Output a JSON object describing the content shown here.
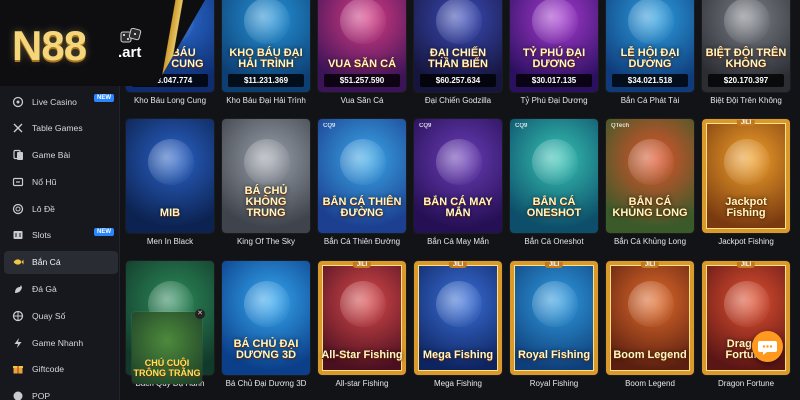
{
  "brand": {
    "logo": "N88",
    "suffix": ".art"
  },
  "nav": [
    {
      "id": "live-casino",
      "label": "Live Casino",
      "icon": "live-casino-icon",
      "badge": "NEW"
    },
    {
      "id": "table-games",
      "label": "Table Games",
      "icon": "table-games-icon"
    },
    {
      "id": "game-bai",
      "label": "Game Bài",
      "icon": "cards-icon"
    },
    {
      "id": "no-hu",
      "label": "Nổ Hũ",
      "icon": "jackpot-icon"
    },
    {
      "id": "lo-de",
      "label": "Lô Đề",
      "icon": "lottery-ball-icon"
    },
    {
      "id": "slots",
      "label": "Slots",
      "icon": "slot-machine-icon",
      "badge": "NEW"
    },
    {
      "id": "ban-ca",
      "label": "Bắn Cá",
      "icon": "fish-icon",
      "active": true
    },
    {
      "id": "da-ga",
      "label": "Đá Gà",
      "icon": "rooster-icon"
    },
    {
      "id": "quay-so",
      "label": "Quay Số",
      "icon": "wheel-icon"
    },
    {
      "id": "game-nhanh",
      "label": "Game Nhanh",
      "icon": "lightning-icon"
    },
    {
      "id": "giftcode",
      "label": "Giftcode",
      "icon": "gift-icon"
    },
    {
      "id": "pop",
      "label": "POP",
      "icon": "pop-icon"
    }
  ],
  "games": [
    {
      "name": "Kho Báu Long Cung",
      "art": "KHO BÁU LONG CUNG",
      "jackpot": "$23.047.774",
      "bg": [
        "#2b6fd6",
        "#0e2c6e"
      ]
    },
    {
      "name": "Kho Báu Đại Hải Trình",
      "art": "KHO BÁU ĐẠI HẢI TRÌNH",
      "jackpot": "$11.231.369",
      "bg": [
        "#2593d8",
        "#0d3f73"
      ]
    },
    {
      "name": "Vua Săn Cá",
      "art": "VUA SĂN CÁ",
      "jackpot": "$51.257.590",
      "bg": [
        "#d63b83",
        "#3b1357"
      ]
    },
    {
      "name": "Đại Chiến Godzilla",
      "art": "ĐẠI CHIẾN THẦN BIỂN",
      "jackpot": "$60.257.634",
      "bg": [
        "#3a4bb8",
        "#16153d"
      ]
    },
    {
      "name": "Tỷ Phú Đại Dương",
      "art": "TỶ PHÚ ĐẠI DƯƠNG",
      "jackpot": "$30.017.135",
      "bg": [
        "#a63ad0",
        "#2c1060"
      ]
    },
    {
      "name": "Bắn Cá Phát Tài",
      "art": "LỄ HỘI ĐẠI DƯƠNG",
      "jackpot": "$34.021.518",
      "bg": [
        "#2c9fe0",
        "#0f3b7a"
      ]
    },
    {
      "name": "Biệt Đội Trên Không",
      "art": "BIỆT ĐỘI TRÊN KHÔNG",
      "jackpot": "$20.170.397",
      "bg": [
        "#7a7d86",
        "#2b2d33"
      ]
    },
    {
      "name": "Men In Black",
      "art": "MIB",
      "bg": [
        "#2a63c8",
        "#0c2250"
      ]
    },
    {
      "name": "King Of The Sky",
      "art": "BÁ CHỦ KHÔNG TRUNG",
      "bg": [
        "#9aa0aa",
        "#3f444c"
      ]
    },
    {
      "name": "Bắn Cá Thiên Đường",
      "art": "BẮN CÁ THIÊN ĐƯỜNG",
      "bg": [
        "#3aa8e8",
        "#1c3f90"
      ]
    },
    {
      "name": "Bắn Cá May Mắn",
      "art": "BẮN CÁ MAY MẮN",
      "bg": [
        "#6a3db8",
        "#261055"
      ]
    },
    {
      "name": "Bắn Cá Oneshot",
      "art": "BẮN CÁ ONESHOT",
      "bg": [
        "#37c3b4",
        "#0d4f6a"
      ]
    },
    {
      "name": "Bắn Cá Khủng Long",
      "art": "BẮN CÁ KHỦNG LONG",
      "bg": [
        "#e0532b",
        "#3a5a2a"
      ]
    },
    {
      "name": "Jackpot Fishing",
      "art": "Jackpot Fishing",
      "bg": [
        "#f0a02a",
        "#7a3a10"
      ],
      "jili": true
    },
    {
      "name": "Bách Quỷ Dạ Hành",
      "art": "",
      "bg": [
        "#2c8a5a",
        "#123a2a"
      ]
    },
    {
      "name": "Bá Chủ Đại Dương 3D",
      "art": "BÁ CHỦ ĐẠI DƯƠNG 3D",
      "bg": [
        "#35a8f0",
        "#0c3f8a"
      ]
    },
    {
      "name": "All-star Fishing",
      "art": "All-Star Fishing",
      "bg": [
        "#d8484a",
        "#4a1020"
      ],
      "jili": true
    },
    {
      "name": "Mega Fishing",
      "art": "Mega Fishing",
      "bg": [
        "#3a6fd8",
        "#0e2460"
      ],
      "jili": true
    },
    {
      "name": "Royal Fishing",
      "art": "Royal Fishing",
      "bg": [
        "#2f9be0",
        "#0f3f7a"
      ],
      "jili": true
    },
    {
      "name": "Boom Legend",
      "art": "Boom Legend",
      "bg": [
        "#e06a2a",
        "#5a1f10"
      ],
      "jili": true
    },
    {
      "name": "Dragon Fortune",
      "art": "Dragon Fortune",
      "bg": [
        "#e05030",
        "#5a1515"
      ],
      "jili": true
    }
  ],
  "promo": {
    "art": "CHÚ CUỘI TRÔNG TRĂNG"
  },
  "jili_tag": "JILI",
  "providers": {
    "cq9": "CQ9",
    "qtech": "QTech"
  },
  "colors": {
    "accent_gold": "#f6d67a",
    "active_nav": "#2a2c33",
    "new_badge": "#2a86ff",
    "chat": "#ff9a1f"
  }
}
